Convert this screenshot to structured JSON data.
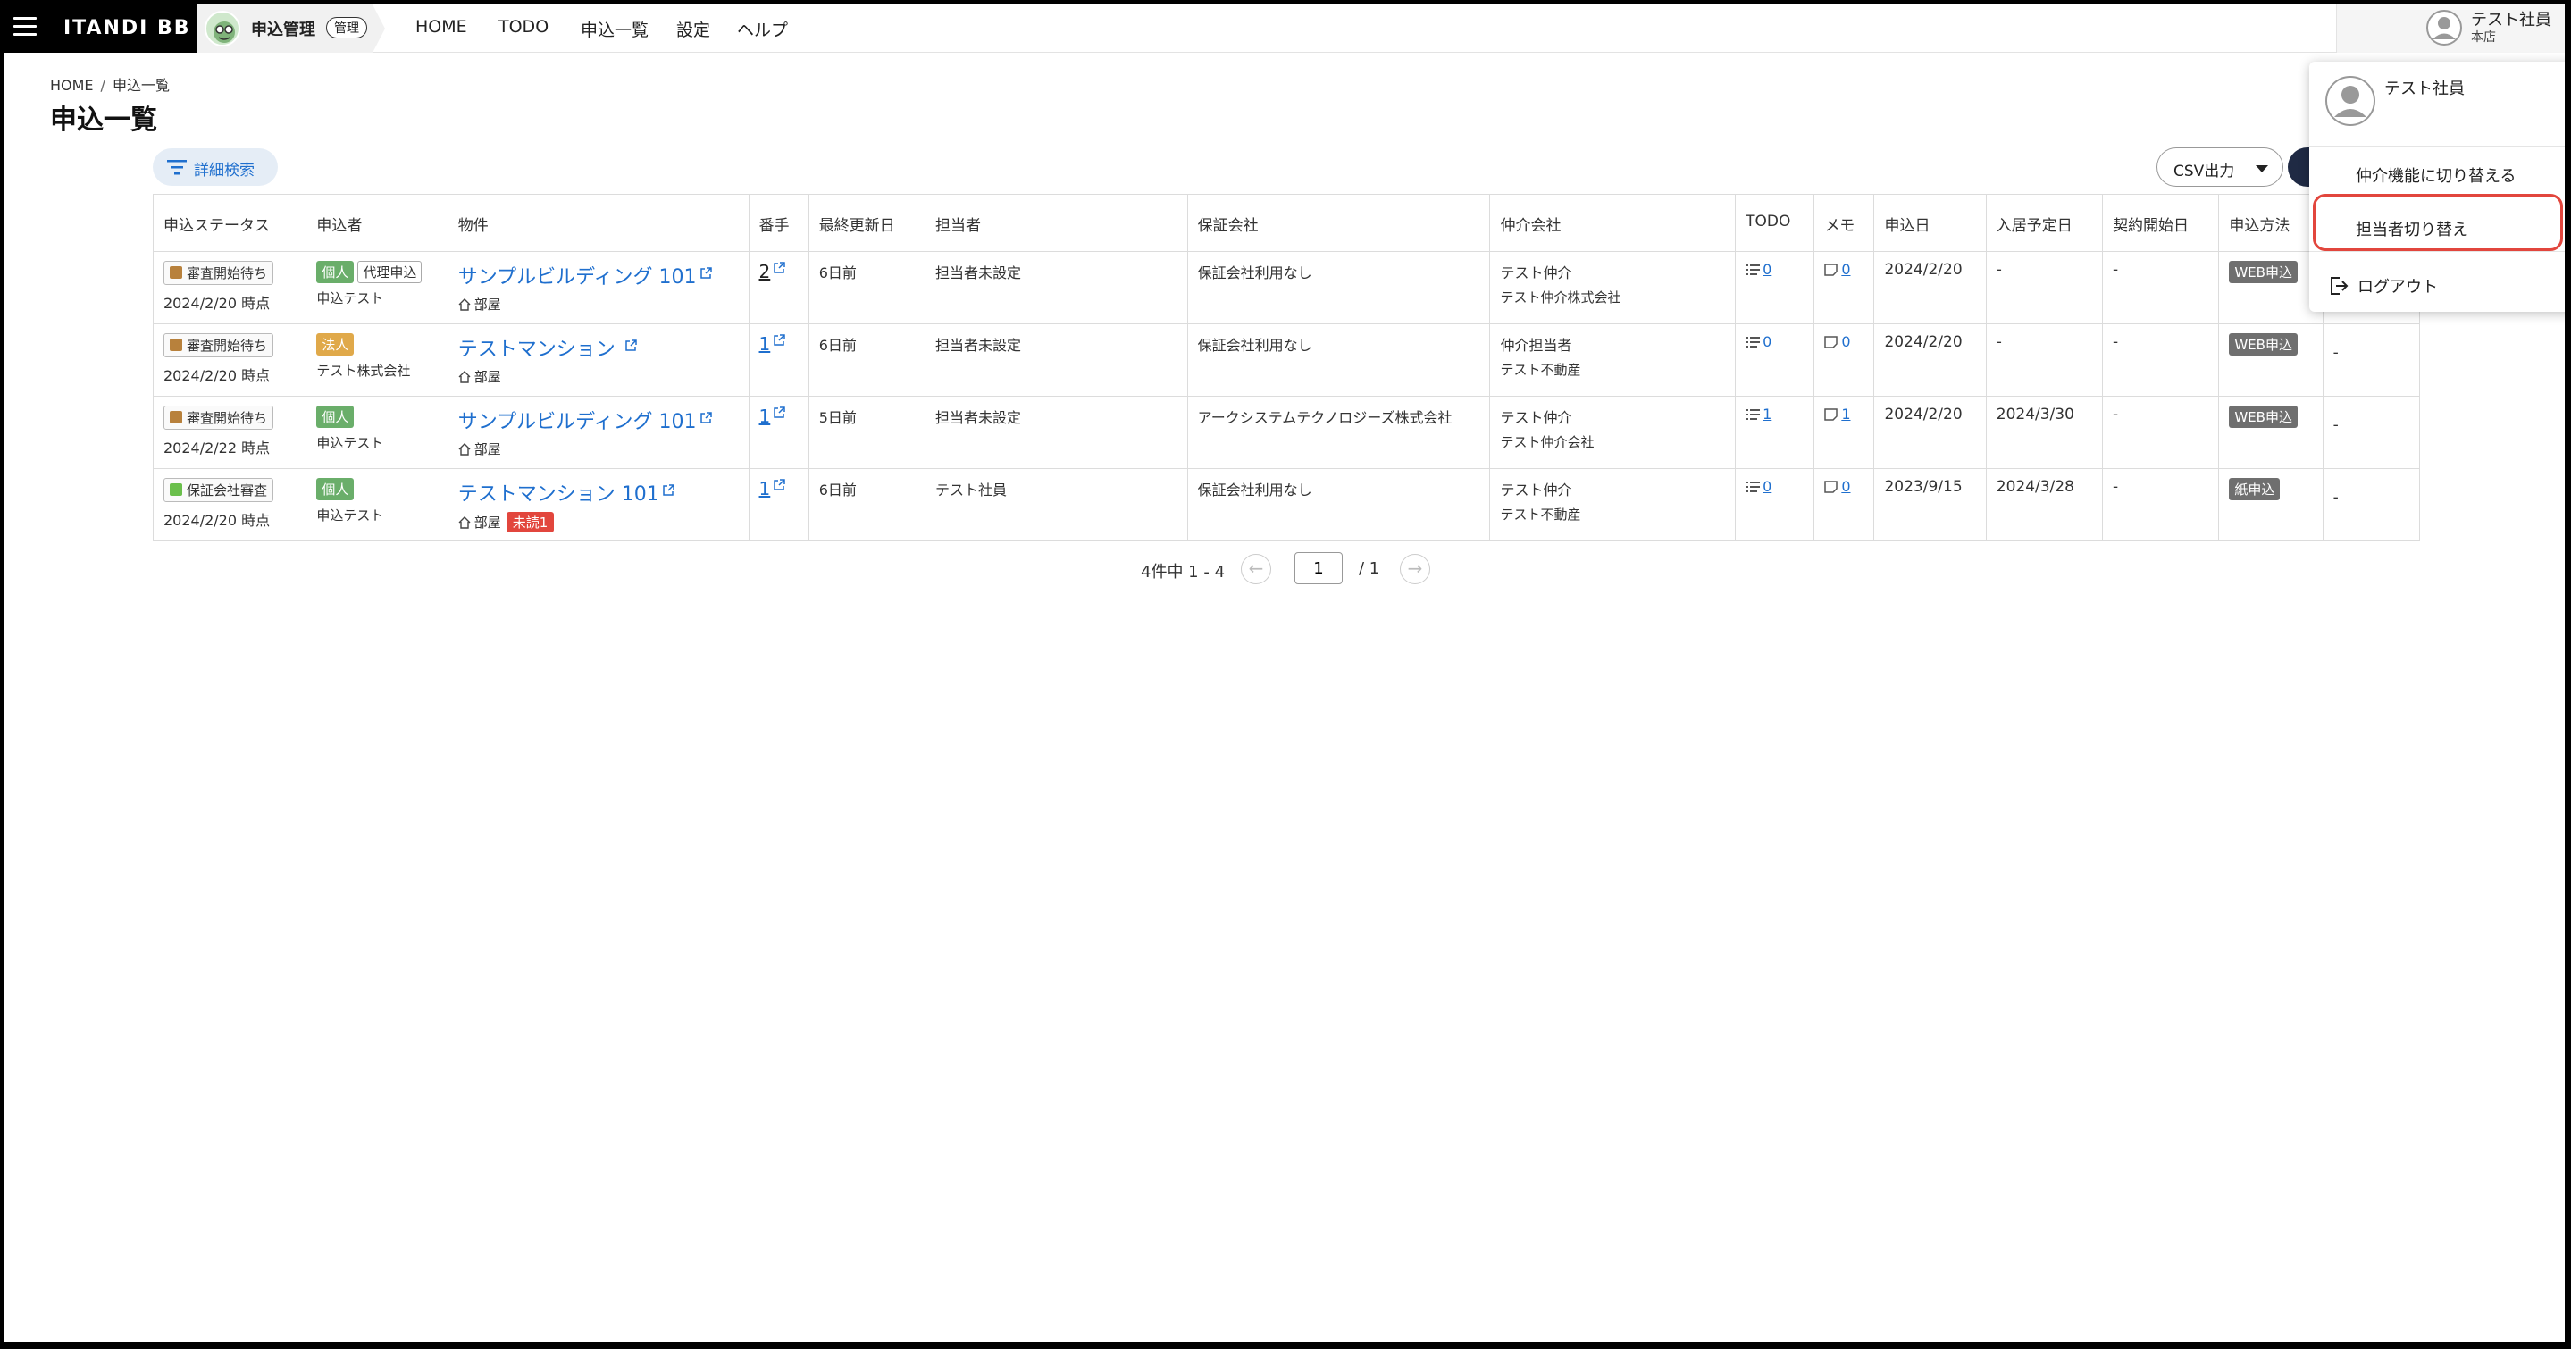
{
  "header": {
    "brand": "ITANDI BB",
    "app_title": "申込管理",
    "app_badge": "管理",
    "nav": [
      "HOME",
      "TODO",
      "申込一覧",
      "設定",
      "ヘルプ"
    ],
    "user_name": "テスト社員",
    "user_branch": "本店"
  },
  "page": {
    "breadcrumb": [
      "HOME",
      "申込一覧"
    ],
    "title": "申込一覧",
    "detail_search": "詳細検索",
    "csv_button": "CSV出力"
  },
  "table": {
    "columns": [
      "申込ステータス",
      "申込者",
      "物件",
      "番手",
      "最終更新日",
      "担当者",
      "保証会社",
      "仲介会社",
      "TODO",
      "メモ",
      "申込日",
      "入居予定日",
      "契約開始日",
      "申込方法"
    ],
    "rows": [
      {
        "status": "審査開始待ち",
        "status_color": "#b8813c",
        "status_time": "2024/2/20 時点",
        "applicant_type": "個人",
        "applicant_type_color": "#6aae6a",
        "proxy": "代理申込",
        "applicant_name": "申込テスト",
        "property": "サンプルビルディング 101",
        "room_label": "部屋",
        "unread": "",
        "order": "2",
        "updated": "6日前",
        "staff": "担当者未設定",
        "guarantor": "保証会社利用なし",
        "broker_person": "テスト仲介",
        "broker_company": "テスト仲介株式会社",
        "todo": "0",
        "memo": "0",
        "applied": "2024/2/20",
        "move_in": "-",
        "contract_start": "-",
        "method": "WEB申込"
      },
      {
        "status": "審査開始待ち",
        "status_color": "#b8813c",
        "status_time": "2024/2/20 時点",
        "applicant_type": "法人",
        "applicant_type_color": "#e0a94a",
        "proxy": "",
        "applicant_name": "テスト株式会社",
        "property": "テストマンション ",
        "room_label": "部屋",
        "unread": "",
        "order": "1",
        "updated": "6日前",
        "staff": "担当者未設定",
        "guarantor": "保証会社利用なし",
        "broker_person": "仲介担当者",
        "broker_company": "テスト不動産",
        "todo": "0",
        "memo": "0",
        "applied": "2024/2/20",
        "move_in": "-",
        "contract_start": "-",
        "method": "WEB申込"
      },
      {
        "status": "審査開始待ち",
        "status_color": "#b8813c",
        "status_time": "2024/2/22 時点",
        "applicant_type": "個人",
        "applicant_type_color": "#6aae6a",
        "proxy": "",
        "applicant_name": "申込テスト",
        "property": "サンプルビルディング 101",
        "room_label": "部屋",
        "unread": "",
        "order": "1",
        "updated": "5日前",
        "staff": "担当者未設定",
        "guarantor": "アークシステムテクノロジーズ株式会社",
        "broker_person": "テスト仲介",
        "broker_company": "テスト仲介会社",
        "todo": "1",
        "memo": "1",
        "applied": "2024/2/20",
        "move_in": "2024/3/30",
        "contract_start": "-",
        "method": "WEB申込"
      },
      {
        "status": "保証会社審査",
        "status_color": "#6abf4b",
        "status_time": "2024/2/20 時点",
        "applicant_type": "個人",
        "applicant_type_color": "#6aae6a",
        "proxy": "",
        "applicant_name": "申込テスト",
        "property": "テストマンション 101",
        "room_label": "部屋",
        "unread": "未読1",
        "order": "1",
        "updated": "6日前",
        "staff": "テスト社員",
        "guarantor": "保証会社利用なし",
        "broker_person": "テスト仲介",
        "broker_company": "テスト不動産",
        "todo": "0",
        "memo": "0",
        "applied": "2023/9/15",
        "move_in": "2024/3/28",
        "contract_start": "-",
        "method": "紙申込"
      }
    ],
    "trailing": "-"
  },
  "pagination": {
    "count_text": "4件中 1 - 4",
    "current_page": "1",
    "total_text": "/ 1"
  },
  "dropdown": {
    "user_name": "テスト社員",
    "switch_agent": "仲介機能に切り替える",
    "switch_staff": "担当者切り替え",
    "logout": "ログアウト"
  },
  "colors": {
    "accent": "#1f6fce",
    "highlight": "#e2463d",
    "brand_bg": "#000000"
  }
}
